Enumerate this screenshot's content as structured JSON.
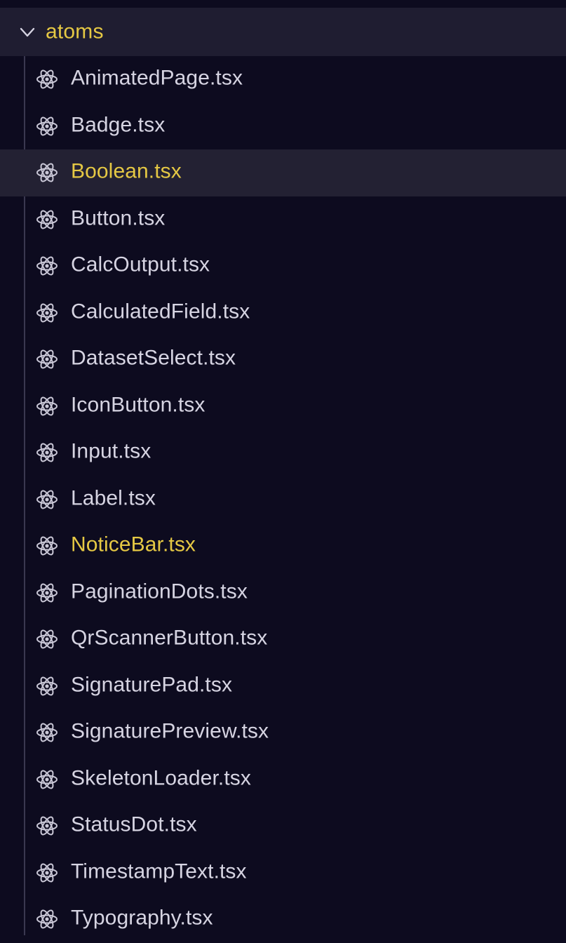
{
  "explorer": {
    "folder": {
      "name": "atoms",
      "expanded": true,
      "chevron_icon": "chevron-down-icon"
    },
    "file_icon": "react-icon",
    "colors": {
      "background": "#0d0b1f",
      "folder_row_bg": "#1f1d31",
      "selected_row_bg": "#232133",
      "default_text": "#d6d4e2",
      "modified_text": "#e5c844",
      "icon": "#c9c7d6"
    },
    "files": [
      {
        "name": "AnimatedPage.tsx",
        "modified": false,
        "selected": false
      },
      {
        "name": "Badge.tsx",
        "modified": false,
        "selected": false
      },
      {
        "name": "Boolean.tsx",
        "modified": true,
        "selected": true
      },
      {
        "name": "Button.tsx",
        "modified": false,
        "selected": false
      },
      {
        "name": "CalcOutput.tsx",
        "modified": false,
        "selected": false
      },
      {
        "name": "CalculatedField.tsx",
        "modified": false,
        "selected": false
      },
      {
        "name": "DatasetSelect.tsx",
        "modified": false,
        "selected": false
      },
      {
        "name": "IconButton.tsx",
        "modified": false,
        "selected": false
      },
      {
        "name": "Input.tsx",
        "modified": false,
        "selected": false
      },
      {
        "name": "Label.tsx",
        "modified": false,
        "selected": false
      },
      {
        "name": "NoticeBar.tsx",
        "modified": true,
        "selected": false
      },
      {
        "name": "PaginationDots.tsx",
        "modified": false,
        "selected": false
      },
      {
        "name": "QrScannerButton.tsx",
        "modified": false,
        "selected": false
      },
      {
        "name": "SignaturePad.tsx",
        "modified": false,
        "selected": false
      },
      {
        "name": "SignaturePreview.tsx",
        "modified": false,
        "selected": false
      },
      {
        "name": "SkeletonLoader.tsx",
        "modified": false,
        "selected": false
      },
      {
        "name": "StatusDot.tsx",
        "modified": false,
        "selected": false
      },
      {
        "name": "TimestampText.tsx",
        "modified": false,
        "selected": false
      },
      {
        "name": "Typography.tsx",
        "modified": false,
        "selected": false
      }
    ]
  }
}
